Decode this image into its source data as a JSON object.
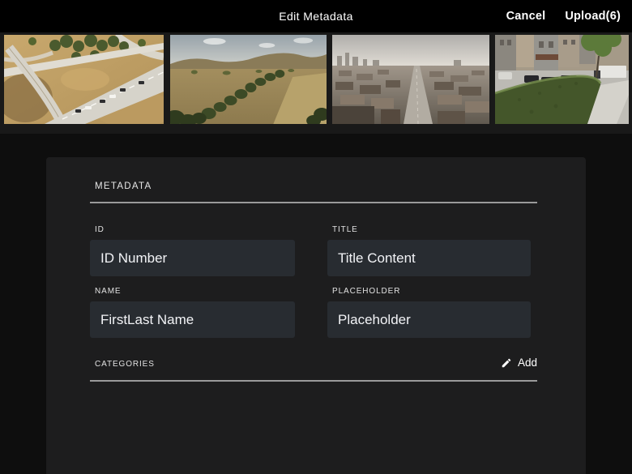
{
  "header": {
    "title": "Edit Metadata",
    "cancel_label": "Cancel",
    "upload_label": "Upload(6)"
  },
  "thumbnails": [
    {
      "name": "aerial-highway-interchange",
      "description": "aerial view of a highway interchange through dry golden hills with trees"
    },
    {
      "name": "aerial-golden-hills",
      "description": "drone view of golden rolling hills with a diagonal tree line under a hazy sky"
    },
    {
      "name": "aerial-hazy-cityscape",
      "description": "hazy aerial view of an industrial cityscape with a road receding to the horizon"
    },
    {
      "name": "street-hedge-scene",
      "description": "street corner with a trimmed green hedge, parked cars and buildings"
    }
  ],
  "form": {
    "section_title": "METADATA",
    "fields": [
      {
        "label": "ID",
        "value": "ID Number"
      },
      {
        "label": "TITLE",
        "value": "Title Content"
      },
      {
        "label": "NAME",
        "value": "FirstLast Name"
      },
      {
        "label": "PLACEHOLDER",
        "value": "Placeholder"
      }
    ],
    "categories": {
      "label": "CATEGORIES",
      "add_label": "Add",
      "add_icon": "pencil-icon"
    }
  },
  "colors": {
    "topbar_bg": "#000000",
    "page_bg": "#0e0e0e",
    "strip_bg": "#191919",
    "panel_bg": "#1d1d1e",
    "input_bg": "#282c31",
    "divider": "#9a9a9a",
    "text": "#f2f3f6"
  }
}
